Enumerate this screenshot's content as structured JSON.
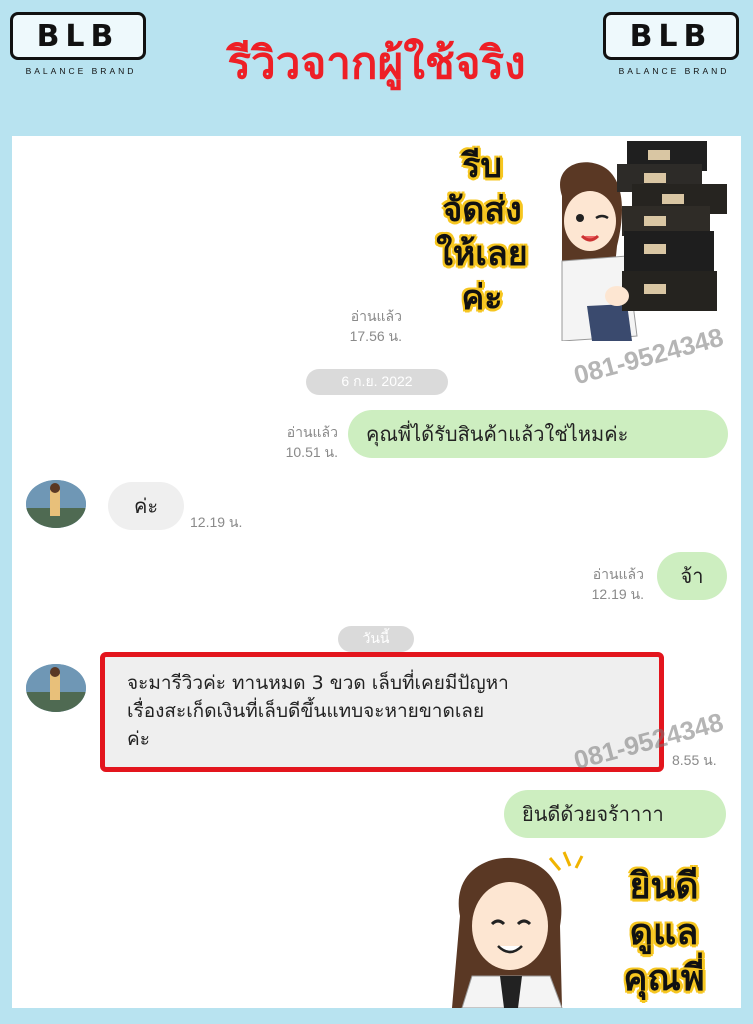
{
  "header": {
    "logo_text": "BLB",
    "logo_sub": "BALANCE BRAND",
    "title": "รีวิวจากผู้ใช้จริง"
  },
  "sticker1": {
    "lines": [
      "รีบ",
      "จัดส่ง",
      "ให้เลย",
      "ค่ะ"
    ]
  },
  "sticker2": {
    "lines": [
      "ยินดี",
      "ดูแล",
      "คุณพี่"
    ]
  },
  "messages": {
    "m1_meta": [
      "อ่านแล้ว",
      "17.56 น."
    ],
    "date1": "6 ก.ย. 2022",
    "m2_text": "คุณพี่ได้รับสินค้าแล้วใช่ไหมค่ะ",
    "m2_meta": [
      "อ่านแล้ว",
      "10.51 น."
    ],
    "m3_text": "ค่ะ",
    "m3_time": "12.19 น.",
    "m4_text": "จ้า",
    "m4_meta": [
      "อ่านแล้ว",
      "12.19 น."
    ],
    "date2": "วันนี้",
    "m5_lines": [
      "จะมารีวิวค่ะ ทานหมด 3 ขวด เล็บที่เคยมีปัญหา",
      "เรื่องสะเก็ดเงินที่เล็บดีขึ้นแทบจะหายขาดเลย",
      "ค่ะ"
    ],
    "m5_time": "8.55 น.",
    "m6_text": "ยินดีด้วยจร้าาาา"
  },
  "watermark": "081-9524348",
  "colors": {
    "background": "#b8e3f0",
    "title": "#ee1f26",
    "outgoing": "#cdeec0",
    "incoming": "#efefef",
    "highlight_border": "#e3151d"
  }
}
